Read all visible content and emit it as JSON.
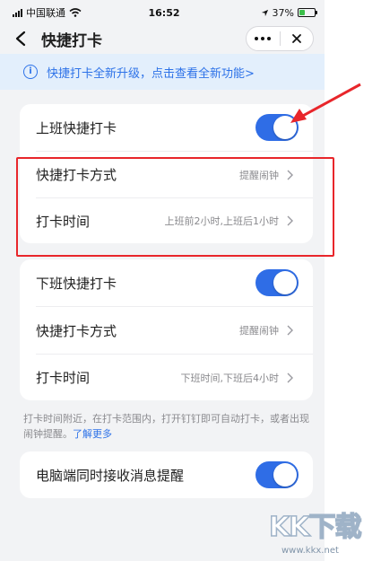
{
  "status_bar": {
    "carrier": "中国联通",
    "time": "16:52",
    "battery": "37%"
  },
  "nav": {
    "title": "快捷打卡"
  },
  "notice": {
    "icon": "info-icon",
    "text": "快捷打卡全新升级，点击查看全新功能>"
  },
  "clock_in": {
    "toggle_label": "上班快捷打卡",
    "toggle_on": true,
    "method_label": "快捷打卡方式",
    "method_value": "提醒闹钟",
    "time_label": "打卡时间",
    "time_value": "上班前2小时,上班后1小时"
  },
  "clock_out": {
    "toggle_label": "下班快捷打卡",
    "toggle_on": true,
    "method_label": "快捷打卡方式",
    "method_value": "提醒闹钟",
    "time_label": "打卡时间",
    "time_value": "下班时间,下班后4小时"
  },
  "hint": {
    "text": "打卡时间附近，在打卡范围内，打开钉钉即可自动打卡，或者出现闹钟提醒。",
    "link": "了解更多"
  },
  "pc_notify": {
    "label": "电脑端同时接收消息提醒",
    "toggle_on": true
  },
  "watermark": {
    "logo": "KK下载",
    "url": "www.kkx.net"
  },
  "colors": {
    "accent": "#2f6de6",
    "highlight_box": "#e8262b",
    "notice_bg": "#e3effc",
    "page_bg": "#f2f3f5"
  }
}
